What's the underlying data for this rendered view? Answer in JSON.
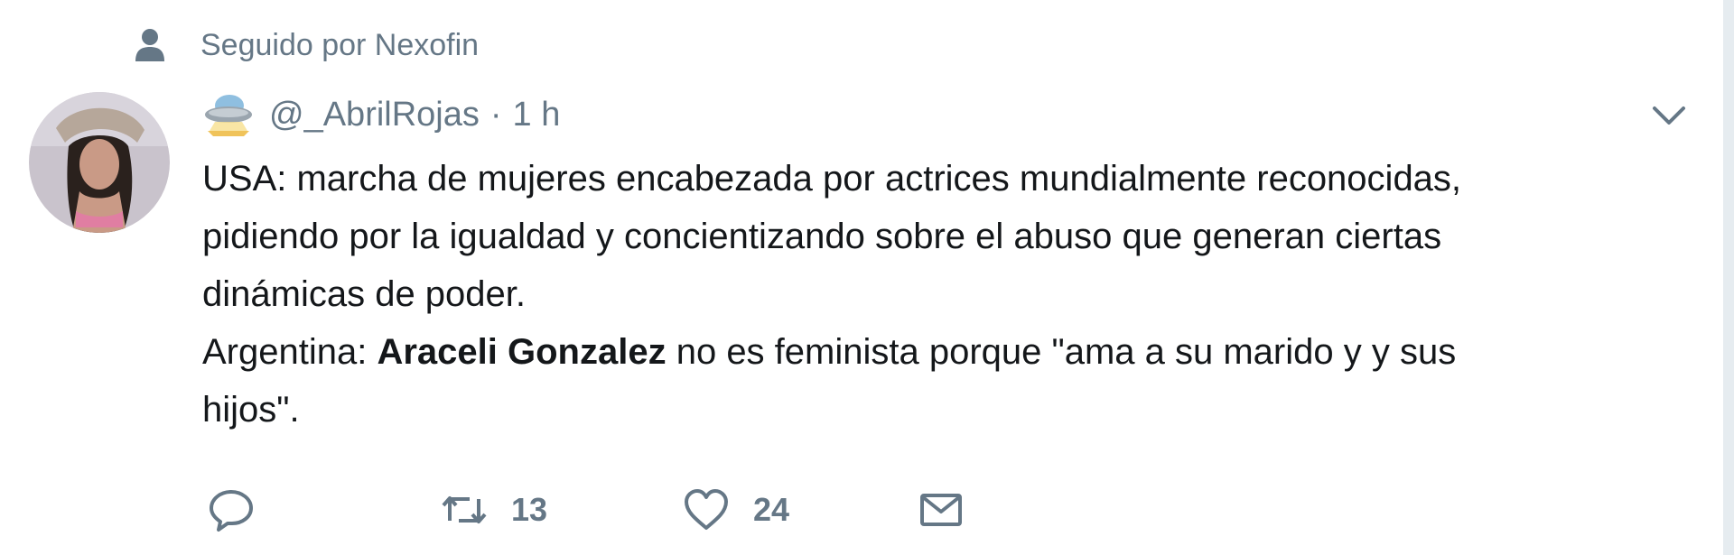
{
  "social_context": {
    "icon": "person-icon",
    "text": "Seguido por Nexofin"
  },
  "author": {
    "handle": "@_AbrilRojas",
    "separator": "·",
    "time": "1 h",
    "badge_icon": "ufo-icon"
  },
  "tweet": {
    "line1": "USA: marcha de mujeres encabezada por actrices mundialmente reconocidas,",
    "line2": "pidiendo por la igualdad y concientizando sobre el abuso que generan ciertas",
    "line3": "dinámicas de poder.",
    "line4_prefix": "Argentina: ",
    "line4_bold": "Araceli Gonzalez",
    "line4_suffix": " no es feminista porque \"ama a su marido y  y sus",
    "line5": "hijos\"."
  },
  "actions": {
    "reply": {
      "icon": "reply-icon"
    },
    "retweet": {
      "icon": "retweet-icon",
      "count": "13"
    },
    "like": {
      "icon": "heart-icon",
      "count": "24"
    },
    "message": {
      "icon": "mail-icon"
    }
  },
  "menu": {
    "icon": "chevron-down-icon"
  },
  "colors": {
    "text": "#14171a",
    "secondary": "#657786",
    "background": "#ffffff"
  }
}
